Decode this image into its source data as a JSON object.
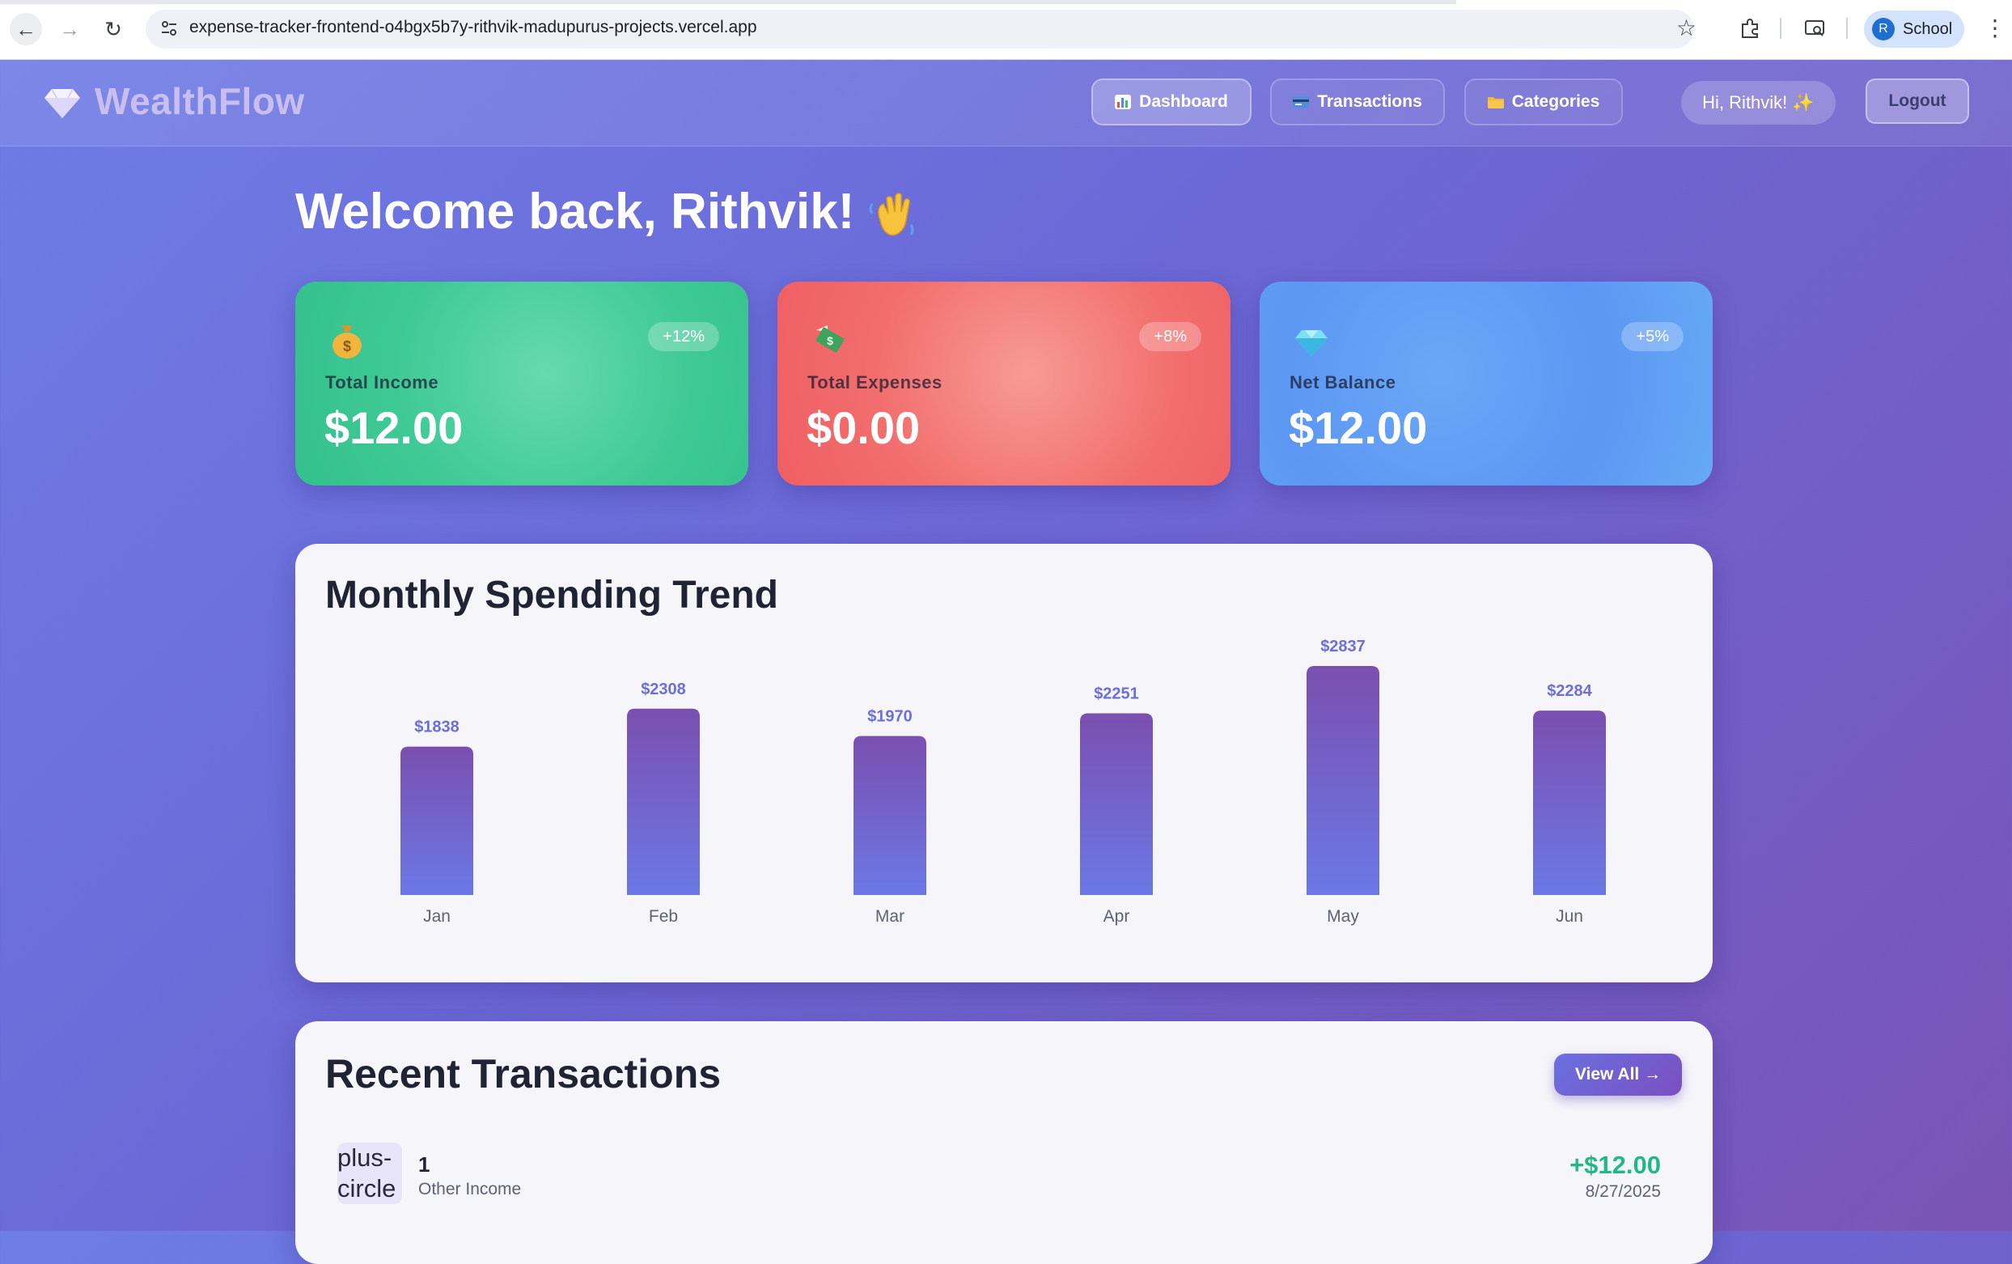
{
  "browser": {
    "url": "expense-tracker-frontend-o4bgx5b7y-rithvik-madupurus-projects.vercel.app",
    "profile_initial": "R",
    "profile_name": "School"
  },
  "header": {
    "logo": "WealthFlow",
    "nav": [
      {
        "label": "Dashboard",
        "icon": "bar-chart-icon",
        "active": true
      },
      {
        "label": "Transactions",
        "icon": "credit-card-icon",
        "active": false
      },
      {
        "label": "Categories",
        "icon": "folder-icon",
        "active": false
      }
    ],
    "greeting": "Hi, Rithvik! ✨",
    "logout_label": "Logout"
  },
  "welcome": {
    "title": "Welcome back, Rithvik!",
    "icon": "waving-hand-icon"
  },
  "stats": [
    {
      "label": "Total Income",
      "value": "$12.00",
      "change": "+12%",
      "icon": "money-bag-icon",
      "color": "#3ec995"
    },
    {
      "label": "Total Expenses",
      "value": "$0.00",
      "change": "+8%",
      "icon": "money-with-wings-icon",
      "color": "#f26e6e"
    },
    {
      "label": "Net Balance",
      "value": "$12.00",
      "change": "+5%",
      "icon": "gem-icon",
      "color": "#5c97f3"
    }
  ],
  "chart_data": {
    "type": "bar",
    "title": "Monthly Spending Trend",
    "categories": [
      "Jan",
      "Feb",
      "Mar",
      "Apr",
      "May",
      "Jun"
    ],
    "values": [
      1838,
      2308,
      1970,
      2251,
      2837,
      2284
    ],
    "value_labels": [
      "$1838",
      "$2308",
      "$1970",
      "$2251",
      "$2837",
      "$2284"
    ],
    "xlabel": "",
    "ylabel": "",
    "grid": false,
    "bar_gradient": [
      "#7b4fb0",
      "#6b78e6"
    ],
    "label_color": "#6b6fd9"
  },
  "recent": {
    "title": "Recent Transactions",
    "view_all_label": "View All →",
    "items": [
      {
        "icon_text": "plus-circle",
        "name": "1",
        "category": "Other Income",
        "amount": "+$12.00",
        "date": "8/27/2025"
      }
    ]
  },
  "colors": {
    "income_green": "#22b882",
    "accent_purple": "#6b68d6"
  }
}
